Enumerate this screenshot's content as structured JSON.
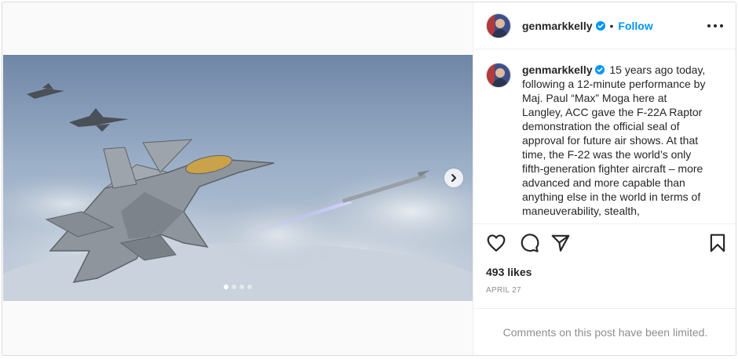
{
  "post": {
    "username": "genmarkkelly",
    "separator": "•",
    "follow_label": "Follow",
    "caption_text": " 15 years ago today, following a 12-minute performance by Maj. Paul “Max” Moga here at Langley, ACC gave the F-22A Raptor demonstration the official seal of approval for future air shows. At that time, the F-22 was the world’s only fifth-generation fighter aircraft – more advanced and more capable than anything else in the world in terms of maneuverability, stealth,",
    "likes": "493 likes",
    "date": "APRIL 27",
    "comments_notice": "Comments on this post have been limited."
  },
  "carousel": {
    "slide_count": 4,
    "active_index": 0
  },
  "icons": {
    "verified": "verified-badge-icon",
    "more": "more-options-icon",
    "like": "heart-icon",
    "comment": "comment-icon",
    "share": "share-icon",
    "save": "bookmark-icon",
    "next": "chevron-right-icon"
  },
  "colors": {
    "accent": "#0095f6",
    "text": "#262626",
    "muted": "#8e8e8e",
    "border": "#dbdbdb"
  }
}
